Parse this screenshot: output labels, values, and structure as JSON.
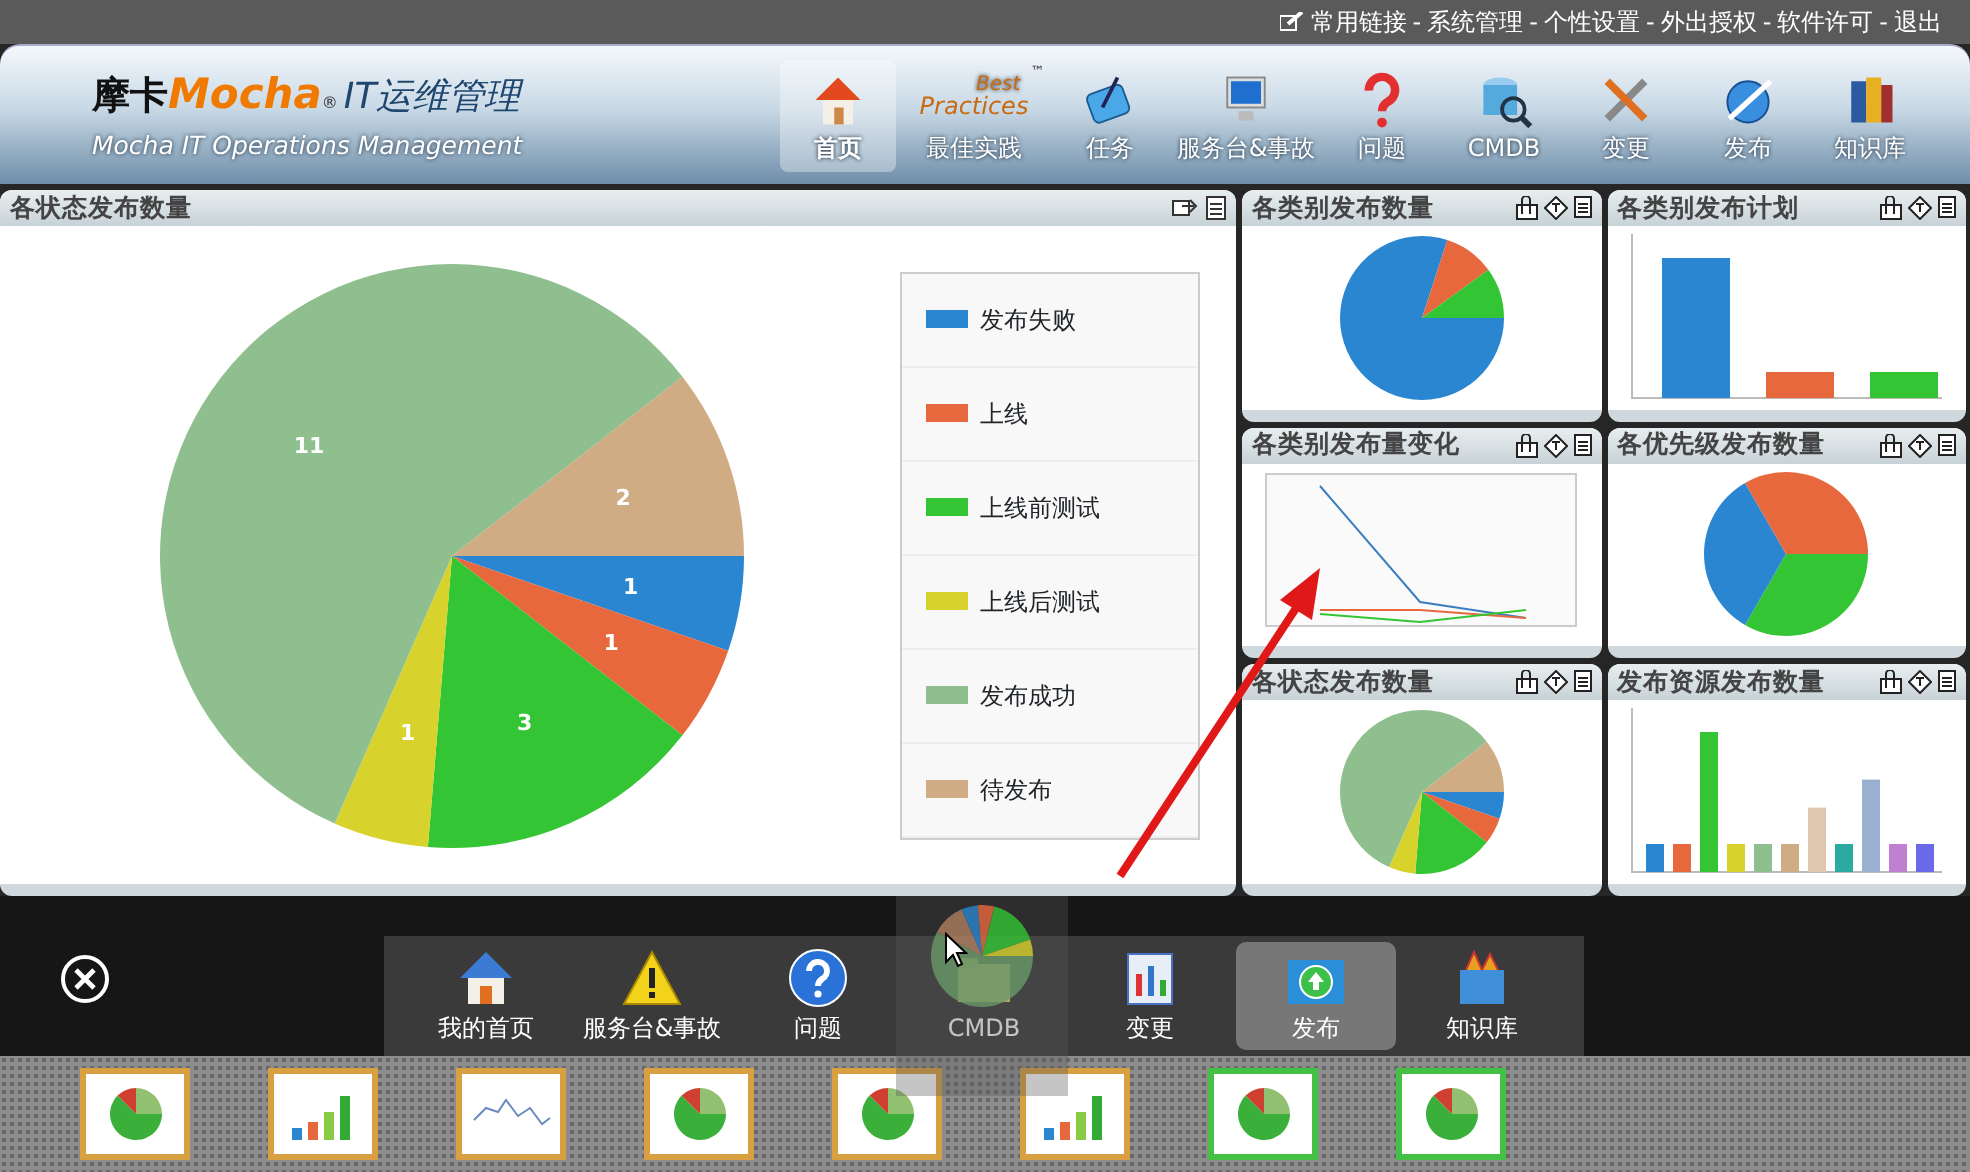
{
  "top_links": {
    "items": [
      "常用链接",
      "系统管理",
      "个性设置",
      "外出授权",
      "软件许可",
      "退出"
    ],
    "separator": "-"
  },
  "logo": {
    "brand_cn": "摩卡",
    "brand_en": "Mocha",
    "registered": "®",
    "product": "IT运维管理",
    "subtitle": "Mocha IT Operations Management"
  },
  "nav": [
    {
      "label": "首页",
      "selected": true
    },
    {
      "label": "最佳实践",
      "selected": false,
      "logo_text": [
        "Best",
        "Practices"
      ],
      "trademark": "™"
    },
    {
      "label": "任务",
      "selected": false
    },
    {
      "label": "服务台&事故",
      "selected": false
    },
    {
      "label": "问题",
      "selected": false
    },
    {
      "label": "CMDB",
      "selected": false
    },
    {
      "label": "变更",
      "selected": false
    },
    {
      "label": "发布",
      "selected": false
    },
    {
      "label": "知识库",
      "selected": false
    }
  ],
  "main_panel": {
    "title": "各状态发布数量",
    "chart_data": {
      "type": "pie",
      "categories": [
        "发布失败",
        "上线",
        "上线前测试",
        "上线后测试",
        "发布成功",
        "待发布"
      ],
      "values": [
        1,
        1,
        3,
        1,
        11,
        2
      ],
      "data_labels": true,
      "colors": [
        "#2a86d0",
        "#e8683e",
        "#33c533",
        "#d8d22c",
        "#8fbf8f",
        "#d0ac84"
      ]
    }
  },
  "small_panels": [
    {
      "title": "各类别发布数量",
      "kind": "pie"
    },
    {
      "title": "各类别发布计划",
      "kind": "bar"
    },
    {
      "title": "各类别发布量变化",
      "kind": "line"
    },
    {
      "title": "各优先级发布数量",
      "kind": "pie3"
    },
    {
      "title": "各状态发布数量",
      "kind": "pie6"
    },
    {
      "title": "发布资源发布数量",
      "kind": "bars"
    }
  ],
  "dock": [
    {
      "label": "我的首页",
      "selected": false
    },
    {
      "label": "服务台&事故",
      "selected": false
    },
    {
      "label": "问题",
      "selected": false
    },
    {
      "label": "CMDB",
      "selected": false
    },
    {
      "label": "变更",
      "selected": false
    },
    {
      "label": "发布",
      "selected": true
    },
    {
      "label": "知识库",
      "selected": false
    }
  ],
  "thumbnails": [
    {
      "kind": "pie",
      "color": "#d8a040"
    },
    {
      "kind": "bar",
      "color": "#d8a040"
    },
    {
      "kind": "line",
      "color": "#d8a040"
    },
    {
      "kind": "pie",
      "color": "#d8a040"
    },
    {
      "kind": "pie",
      "color": "#d8a040"
    },
    {
      "kind": "bar",
      "color": "#d8a040"
    },
    {
      "kind": "pie",
      "color": "#44c044"
    },
    {
      "kind": "pie",
      "color": "#44c044"
    }
  ]
}
